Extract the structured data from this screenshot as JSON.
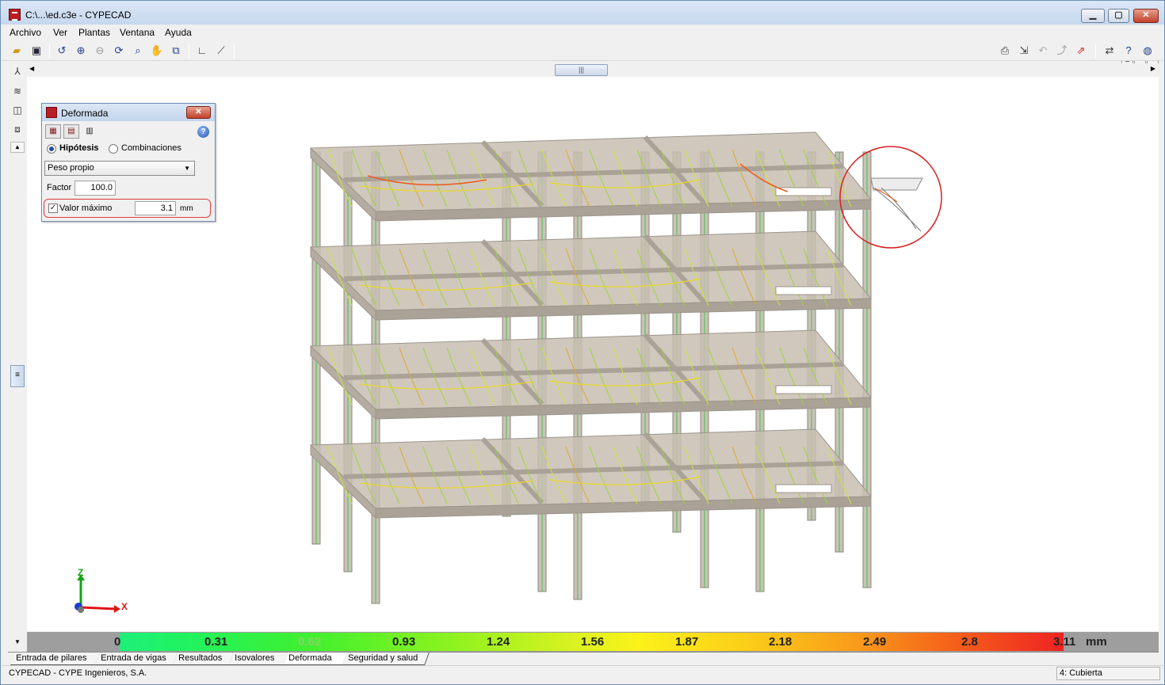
{
  "window": {
    "title": "C:\\...\\ed.c3e - CYPECAD"
  },
  "menu": [
    "Archivo",
    "Ver",
    "Plantas",
    "Ventana",
    "Ayuda"
  ],
  "toolbar_left": [
    "open-folder-icon",
    "save-icon",
    "rotate-view-icon",
    "zoom-fit-icon",
    "zoom-previous-icon",
    "refresh-view-icon",
    "zoom-window-icon",
    "pan-hand-icon",
    "view-window-icon",
    "measure-angle-icon",
    "dimension-icon"
  ],
  "toolbar_right": [
    "print-icon",
    "export-icon",
    "undo-icon",
    "export-dxf-icon",
    "exchange-icon",
    "help-icon",
    "web-icon"
  ],
  "panel": {
    "title": "Deformada",
    "radio_hipotesis": "Hipótesis",
    "radio_combinaciones": "Combinaciones",
    "select_value": "Peso propio",
    "factor_label": "Factor",
    "factor_value": "100.0",
    "max_label": "Valor máximo",
    "max_value": "3.1",
    "max_unit": "mm",
    "help": "?"
  },
  "axes": {
    "z": "Z",
    "x": "X"
  },
  "legend": {
    "ticks": [
      "0",
      "0.31",
      "0.62",
      "0.93",
      "1.24",
      "1.56",
      "1.87",
      "2.18",
      "2.49",
      "2.8",
      "3.11"
    ],
    "unit": "mm",
    "colors": {
      "min": "#1df07a",
      "mid": "#fbf219",
      "max": "#ee2323"
    }
  },
  "tabs": [
    "Entrada de pilares",
    "Entrada de vigas",
    "Resultados",
    "Isovalores",
    "Deformada",
    "Seguridad y salud"
  ],
  "active_tab": "Deformada",
  "status": {
    "left": "CYPECAD - CYPE Ingenieros, S.A.",
    "right": "4: Cubierta"
  }
}
